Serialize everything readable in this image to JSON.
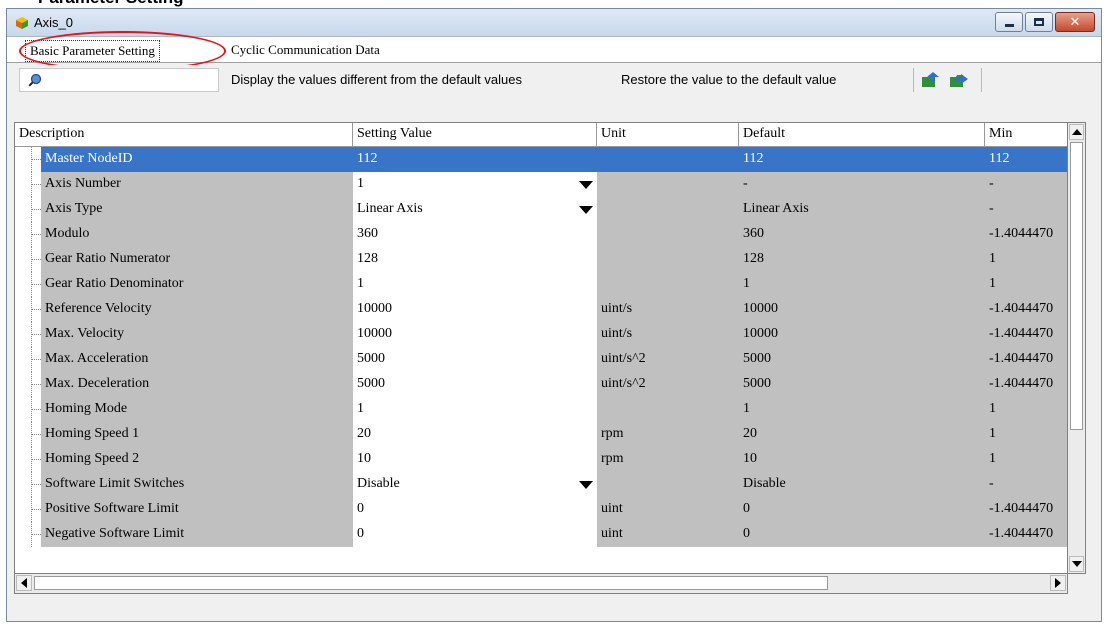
{
  "page": {
    "heading": "Parameter Setting"
  },
  "window": {
    "title": "Axis_0"
  },
  "tabs": [
    {
      "label": "Basic Parameter Setting",
      "active": true
    },
    {
      "label": "Cyclic Communication Data",
      "active": false
    }
  ],
  "toolbar": {
    "search_value": "",
    "show_diff_label": "Display the values different from the default values",
    "restore_label": "Restore the value to the default value"
  },
  "columns": [
    "Description",
    "Setting Value",
    "Unit",
    "Default",
    "Min"
  ],
  "rows": [
    {
      "description": "Master NodeID",
      "value": "112",
      "unit": "",
      "default": "112",
      "min": "112"
    },
    {
      "description": "Axis Number",
      "value": "1",
      "unit": "",
      "default": "-",
      "min": "-"
    },
    {
      "description": "Axis Type",
      "value": "Linear Axis",
      "unit": "",
      "default": "Linear Axis",
      "min": "-"
    },
    {
      "description": "Modulo",
      "value": "360",
      "unit": "",
      "default": "360",
      "min": "-1.4044470"
    },
    {
      "description": "Gear Ratio Numerator",
      "value": "128",
      "unit": "",
      "default": "128",
      "min": "1"
    },
    {
      "description": "Gear Ratio Denominator",
      "value": "1",
      "unit": "",
      "default": "1",
      "min": "1"
    },
    {
      "description": "Reference Velocity",
      "value": "10000",
      "unit": "uint/s",
      "default": "10000",
      "min": "-1.4044470"
    },
    {
      "description": "Max. Velocity",
      "value": "10000",
      "unit": "uint/s",
      "default": "10000",
      "min": "-1.4044470"
    },
    {
      "description": "Max. Acceleration",
      "value": "5000",
      "unit": "uint/s^2",
      "default": "5000",
      "min": "-1.4044470"
    },
    {
      "description": "Max. Deceleration",
      "value": "5000",
      "unit": "uint/s^2",
      "default": "5000",
      "min": "-1.4044470"
    },
    {
      "description": "Homing Mode",
      "value": "1",
      "unit": "",
      "default": "1",
      "min": "1"
    },
    {
      "description": "Homing Speed 1",
      "value": "20",
      "unit": "rpm",
      "default": "20",
      "min": "1"
    },
    {
      "description": "Homing Speed 2",
      "value": "10",
      "unit": "rpm",
      "default": "10",
      "min": "1"
    },
    {
      "description": "Software Limit Switches",
      "value": "Disable",
      "unit": "",
      "default": "Disable",
      "min": "-"
    },
    {
      "description": "Positive Software Limit",
      "value": "0",
      "unit": "uint",
      "default": "0",
      "min": "-1.4044470"
    },
    {
      "description": "Negative Software Limit",
      "value": "0",
      "unit": "uint",
      "default": "0",
      "min": "-1.4044470"
    }
  ],
  "dropdown_rows": [
    1,
    2,
    13
  ],
  "selected_row": 0,
  "colors": {
    "selection": "#3874c8",
    "highlight_ring": "#e0141c",
    "readonly_cell": "#c0c0c0"
  }
}
